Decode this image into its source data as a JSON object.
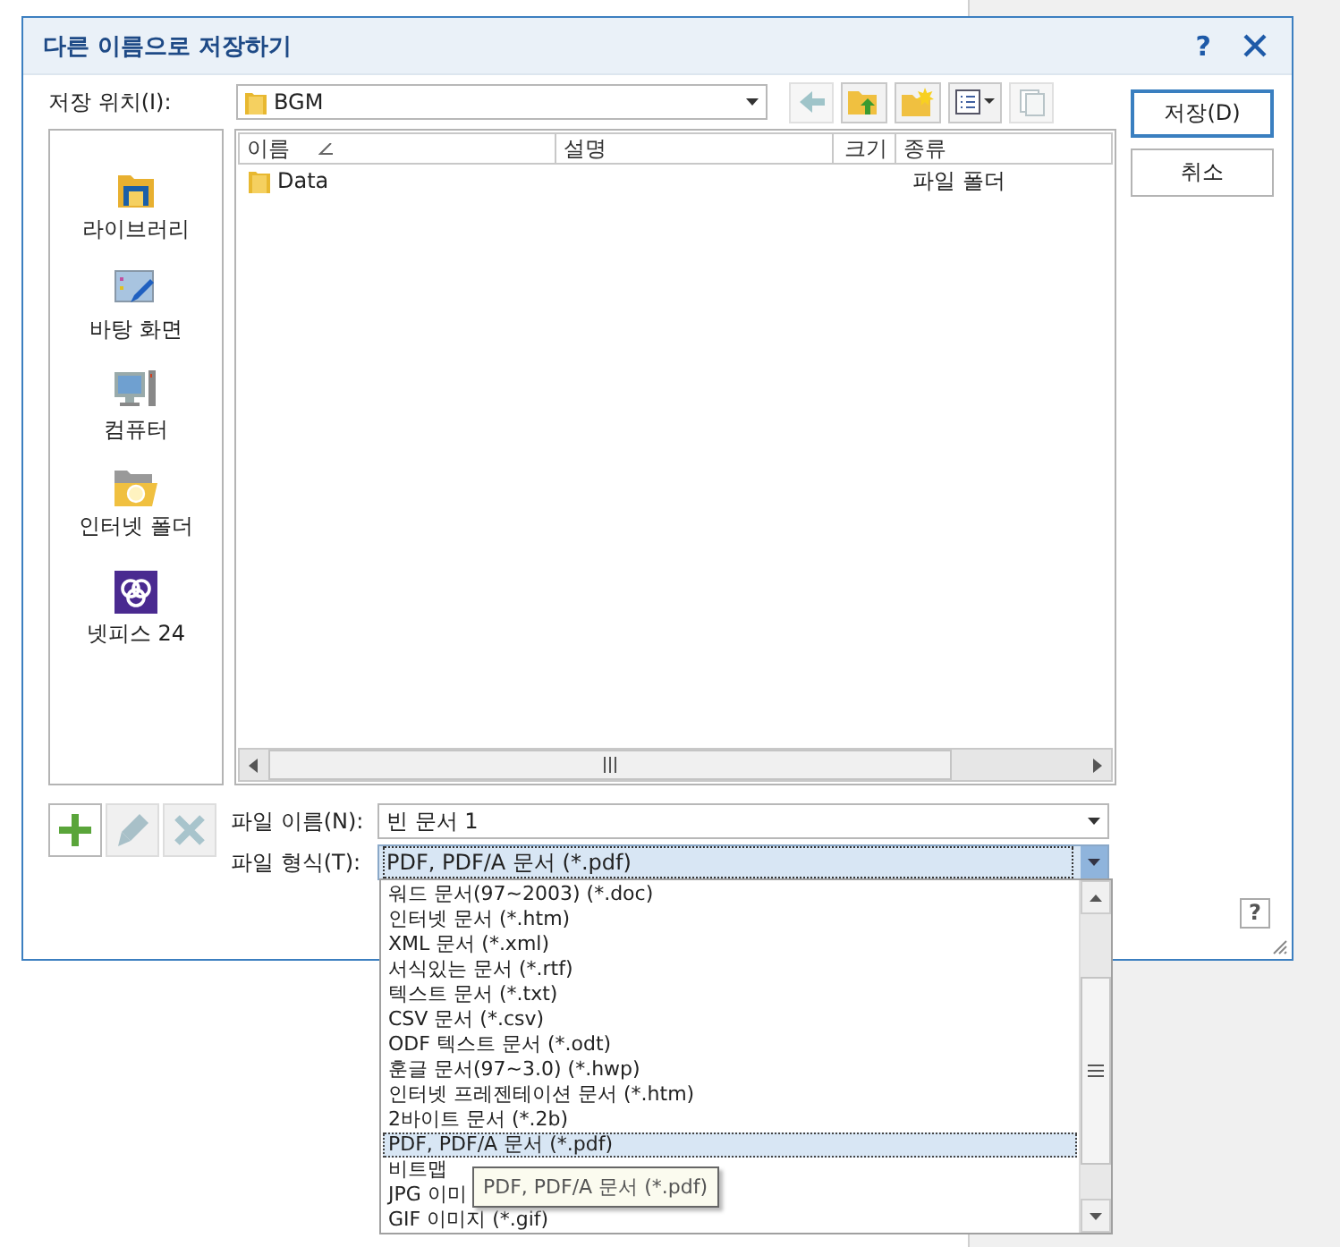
{
  "dialog": {
    "title": "다른 이름으로 저장하기",
    "help_button": "?"
  },
  "save_in": {
    "label": "저장 위치(I):",
    "value": "BGM"
  },
  "toolbar": [
    {
      "kind": "back",
      "disabled": true
    },
    {
      "kind": "up",
      "disabled": false
    },
    {
      "kind": "new-folder",
      "disabled": false
    },
    {
      "kind": "view",
      "disabled": false
    },
    {
      "kind": "preview",
      "disabled": true
    }
  ],
  "buttons": [
    {
      "label": "저장(D)",
      "default": true
    },
    {
      "label": "취소",
      "default": false
    }
  ],
  "places": [
    {
      "kind": "library",
      "label": "라이브러리"
    },
    {
      "kind": "desktop",
      "label": "바탕 화면"
    },
    {
      "kind": "computer",
      "label": "컴퓨터"
    },
    {
      "kind": "internet-folder",
      "label": "인터넷 폴더"
    },
    {
      "kind": "app",
      "label": "넷피스 24"
    }
  ],
  "file_list": {
    "columns": [
      {
        "label": "이름",
        "sorted": true
      },
      {
        "label": "설명",
        "sorted": false
      },
      {
        "label": "크기",
        "sorted": false
      },
      {
        "label": "종류",
        "sorted": false
      }
    ],
    "rows": [
      {
        "name": "Data",
        "type": "파일 폴더"
      }
    ]
  },
  "place_buttons": [
    {
      "kind": "add",
      "disabled": false
    },
    {
      "kind": "edit",
      "disabled": true
    },
    {
      "kind": "delete",
      "disabled": true
    }
  ],
  "file_name": {
    "label": "파일 이름(N):",
    "value": "빈 문서 1"
  },
  "file_type": {
    "label": "파일 형식(T):",
    "value": "PDF, PDF/A 문서 (*.pdf)",
    "options": [
      {
        "label": "워드 문서(97~2003) (*.doc)",
        "selected": false
      },
      {
        "label": "인터넷 문서 (*.htm)",
        "selected": false
      },
      {
        "label": "XML 문서 (*.xml)",
        "selected": false
      },
      {
        "label": "서식있는 문서 (*.rtf)",
        "selected": false
      },
      {
        "label": "텍스트 문서 (*.txt)",
        "selected": false
      },
      {
        "label": "CSV 문서 (*.csv)",
        "selected": false
      },
      {
        "label": "ODF 텍스트 문서 (*.odt)",
        "selected": false
      },
      {
        "label": "훈글 문서(97~3.0) (*.hwp)",
        "selected": false
      },
      {
        "label": "인터넷 프레젠테이션 문서 (*.htm)",
        "selected": false
      },
      {
        "label": "2바이트 문서 (*.2b)",
        "selected": false
      },
      {
        "label": "PDF, PDF/A 문서 (*.pdf)",
        "selected": true
      },
      {
        "label": "비트맵",
        "selected": false
      },
      {
        "label": "JPG 이미",
        "selected": false
      },
      {
        "label": "GIF 이미지 (*.gif)",
        "selected": false
      }
    ]
  },
  "tooltip": "PDF, PDF/A 문서 (*.pdf)"
}
